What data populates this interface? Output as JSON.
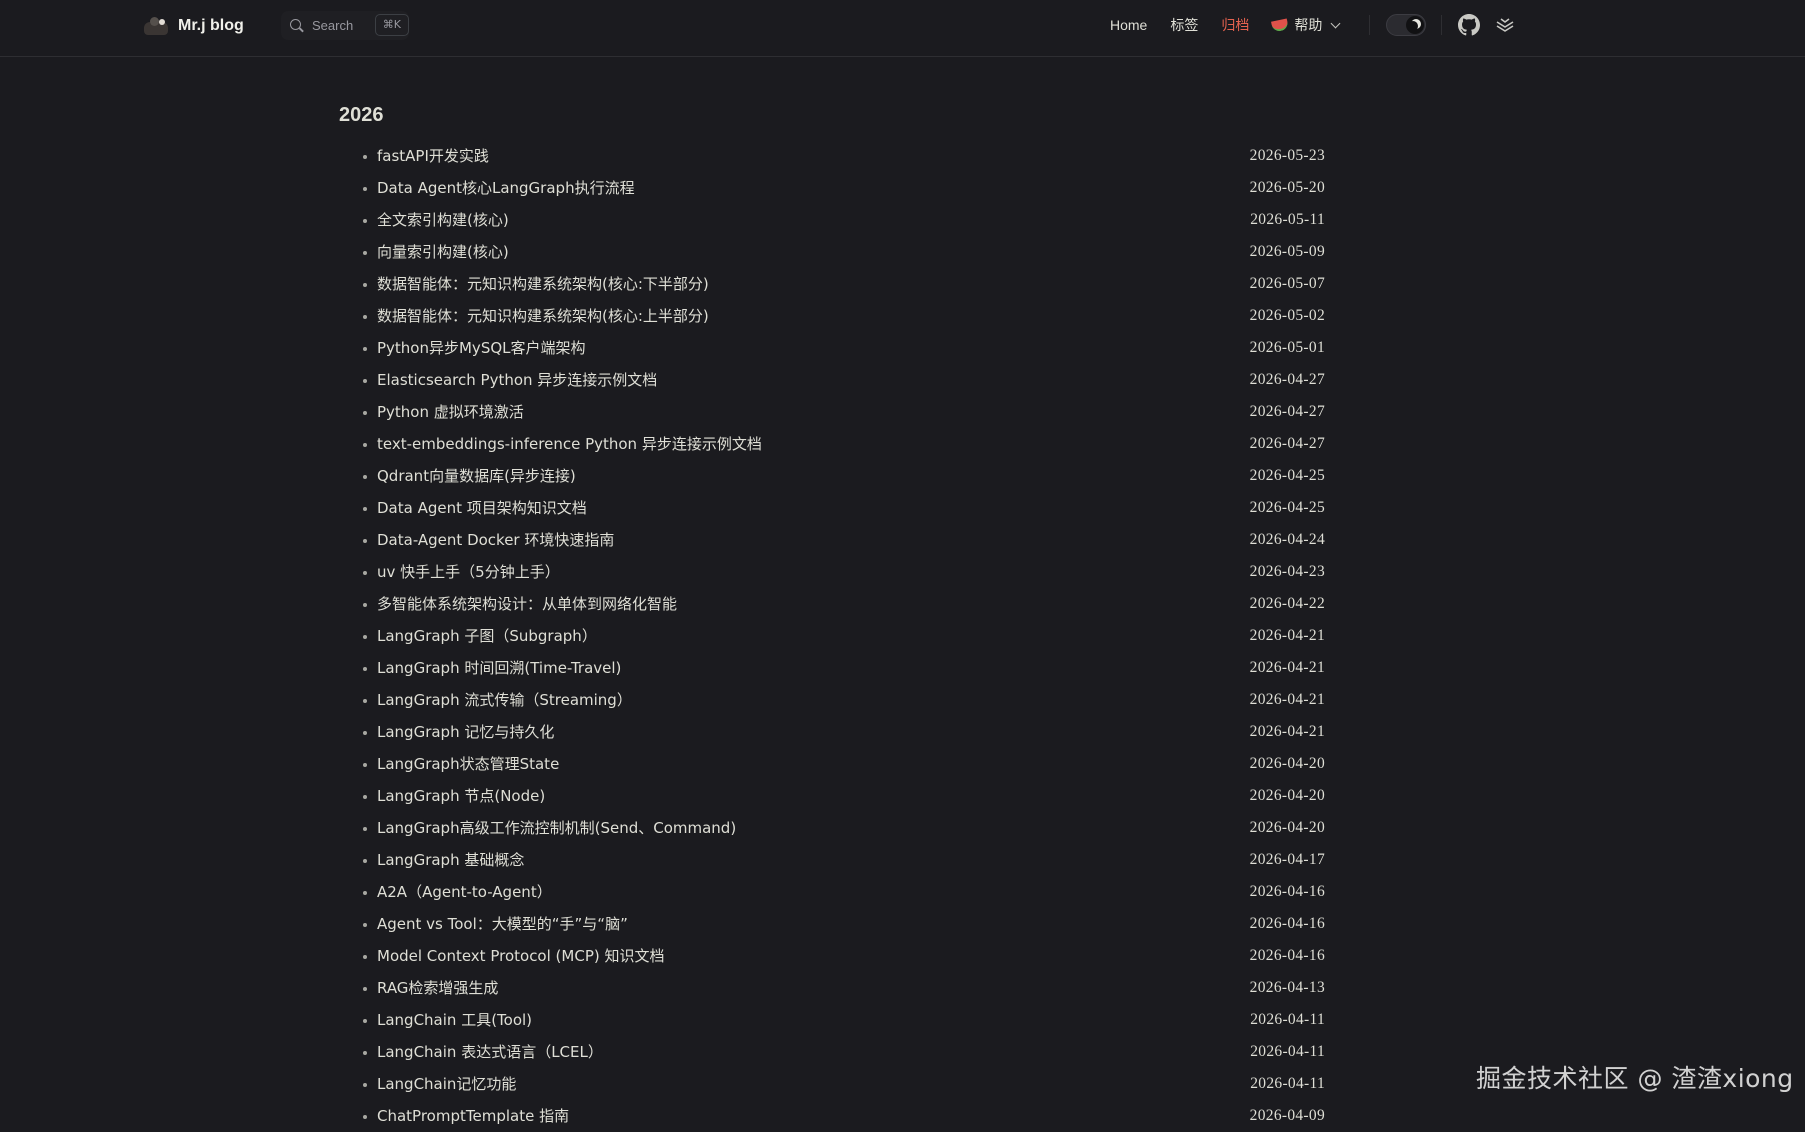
{
  "nav": {
    "brand": "Mr.j blog",
    "search_placeholder": "Search",
    "search_shortcut": "⌘K",
    "links": [
      "Home",
      "标签",
      "归档"
    ],
    "help_label": "帮助",
    "active_color": "#e5624f",
    "icons": [
      "search-icon",
      "moon-icon",
      "github-icon",
      "layers-icon"
    ]
  },
  "archive": {
    "year": "2026",
    "posts": [
      {
        "title": "fastAPI开发实践",
        "date": "2026-05-23"
      },
      {
        "title": "Data Agent核心LangGraph执行流程",
        "date": "2026-05-20"
      },
      {
        "title": "全文索引构建(核心)",
        "date": "2026-05-11"
      },
      {
        "title": "向量索引构建(核心)",
        "date": "2026-05-09"
      },
      {
        "title": "数据智能体：元知识构建系统架构(核心:下半部分)",
        "date": "2026-05-07"
      },
      {
        "title": "数据智能体：元知识构建系统架构(核心:上半部分)",
        "date": "2026-05-02"
      },
      {
        "title": "Python异步MySQL客户端架构",
        "date": "2026-05-01"
      },
      {
        "title": "Elasticsearch Python 异步连接示例文档",
        "date": "2026-04-27"
      },
      {
        "title": "Python 虚拟环境激活",
        "date": "2026-04-27"
      },
      {
        "title": "text-embeddings-inference Python 异步连接示例文档",
        "date": "2026-04-27"
      },
      {
        "title": "Qdrant向量数据库(异步连接)",
        "date": "2026-04-25"
      },
      {
        "title": "Data Agent 项目架构知识文档",
        "date": "2026-04-25"
      },
      {
        "title": "Data-Agent Docker 环境快速指南",
        "date": "2026-04-24"
      },
      {
        "title": "uv 快手上手（5分钟上手）",
        "date": "2026-04-23"
      },
      {
        "title": "多智能体系统架构设计：从单体到网络化智能",
        "date": "2026-04-22"
      },
      {
        "title": "LangGraph 子图（Subgraph）",
        "date": "2026-04-21"
      },
      {
        "title": "LangGraph 时间回溯(Time-Travel)",
        "date": "2026-04-21"
      },
      {
        "title": "LangGraph 流式传输（Streaming）",
        "date": "2026-04-21"
      },
      {
        "title": "LangGraph 记忆与持久化",
        "date": "2026-04-21"
      },
      {
        "title": "LangGraph状态管理State",
        "date": "2026-04-20"
      },
      {
        "title": "LangGraph 节点(Node)",
        "date": "2026-04-20"
      },
      {
        "title": "LangGraph高级工作流控制机制(Send、Command)",
        "date": "2026-04-20"
      },
      {
        "title": "LangGraph 基础概念",
        "date": "2026-04-17"
      },
      {
        "title": "A2A（Agent-to-Agent）",
        "date": "2026-04-16"
      },
      {
        "title": "Agent vs Tool：大模型的“手”与“脑”",
        "date": "2026-04-16"
      },
      {
        "title": "Model Context Protocol (MCP) 知识文档",
        "date": "2026-04-16"
      },
      {
        "title": "RAG检索增强生成",
        "date": "2026-04-13"
      },
      {
        "title": "LangChain 工具(Tool)",
        "date": "2026-04-11"
      },
      {
        "title": "LangChain 表达式语言（LCEL）",
        "date": "2026-04-11"
      },
      {
        "title": "LangChain记忆功能",
        "date": "2026-04-11"
      },
      {
        "title": "ChatPromptTemplate 指南",
        "date": "2026-04-09"
      }
    ]
  },
  "watermark": "掘金技术社区 @ 渣渣xiong"
}
